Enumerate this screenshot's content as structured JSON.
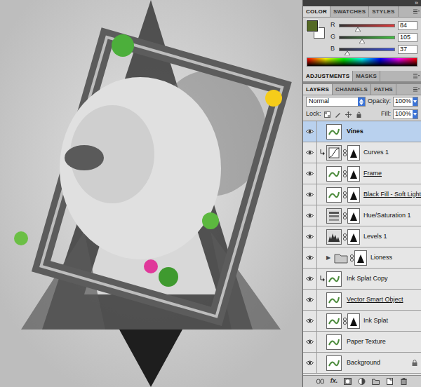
{
  "panel_collapse": "»",
  "color_panel": {
    "tabs": [
      {
        "label": "COLOR",
        "selected": true
      },
      {
        "label": "SWATCHES",
        "selected": false
      },
      {
        "label": "STYLES",
        "selected": false
      }
    ],
    "foreground": "#546925",
    "background": "#ffffff",
    "sliders": [
      {
        "name": "R",
        "value": "84",
        "level": 0.33,
        "color": "#e0383a"
      },
      {
        "name": "G",
        "value": "105",
        "level": 0.41,
        "color": "#3fc23f"
      },
      {
        "name": "B",
        "value": "37",
        "level": 0.145,
        "color": "#3a4fd8"
      }
    ]
  },
  "adjustments_tabs": [
    {
      "label": "ADJUSTMENTS",
      "selected": true
    },
    {
      "label": "MASKS",
      "selected": false
    }
  ],
  "layers_panel": {
    "tabs": [
      {
        "label": "LAYERS",
        "selected": true
      },
      {
        "label": "CHANNELS",
        "selected": false
      },
      {
        "label": "PATHS",
        "selected": false
      }
    ],
    "blend_mode": "Normal",
    "opacity_label": "Opacity:",
    "opacity": "100%",
    "lock_label": "Lock:",
    "fill_label": "Fill:",
    "fill": "100%",
    "layers": [
      {
        "name": "Vines",
        "selected": true,
        "visible": true,
        "kind": "pixel",
        "clipped": false,
        "has_mask": false,
        "smart": false,
        "locked": false
      },
      {
        "name": "Curves 1",
        "selected": false,
        "visible": true,
        "kind": "curves",
        "clipped": true,
        "has_mask": true,
        "smart": false,
        "locked": false
      },
      {
        "name": "Frame",
        "selected": false,
        "visible": true,
        "kind": "pixel",
        "clipped": false,
        "has_mask": true,
        "smart": true,
        "locked": false
      },
      {
        "name": "Black Fill - Soft Light",
        "selected": false,
        "visible": true,
        "kind": "pixel",
        "clipped": false,
        "has_mask": true,
        "smart": true,
        "locked": false
      },
      {
        "name": "Hue/Saturation 1",
        "selected": false,
        "visible": true,
        "kind": "huesat",
        "clipped": false,
        "has_mask": true,
        "smart": false,
        "locked": false
      },
      {
        "name": "Levels 1",
        "selected": false,
        "visible": true,
        "kind": "levels",
        "clipped": false,
        "has_mask": true,
        "smart": false,
        "locked": false
      },
      {
        "name": "Lioness",
        "selected": false,
        "visible": true,
        "kind": "group",
        "expander": "▶",
        "clipped": false,
        "has_mask": true,
        "smart": false,
        "locked": false
      },
      {
        "name": "Ink Splat Copy",
        "selected": false,
        "visible": true,
        "kind": "pixel",
        "clipped": true,
        "has_mask": false,
        "smart": false,
        "locked": false
      },
      {
        "name": "Vector Smart Object",
        "selected": false,
        "visible": true,
        "kind": "pixel",
        "clipped": false,
        "has_mask": false,
        "smart": true,
        "locked": false
      },
      {
        "name": "Ink Splat",
        "selected": false,
        "visible": true,
        "kind": "pixel",
        "clipped": false,
        "has_mask": true,
        "smart": false,
        "locked": false
      },
      {
        "name": "Paper Texture",
        "selected": false,
        "visible": true,
        "kind": "pixel",
        "clipped": false,
        "has_mask": false,
        "smart": false,
        "locked": false
      },
      {
        "name": "Background",
        "selected": false,
        "visible": true,
        "kind": "pixel",
        "clipped": false,
        "has_mask": false,
        "smart": false,
        "locked": true
      }
    ],
    "fx_label": "fx."
  }
}
